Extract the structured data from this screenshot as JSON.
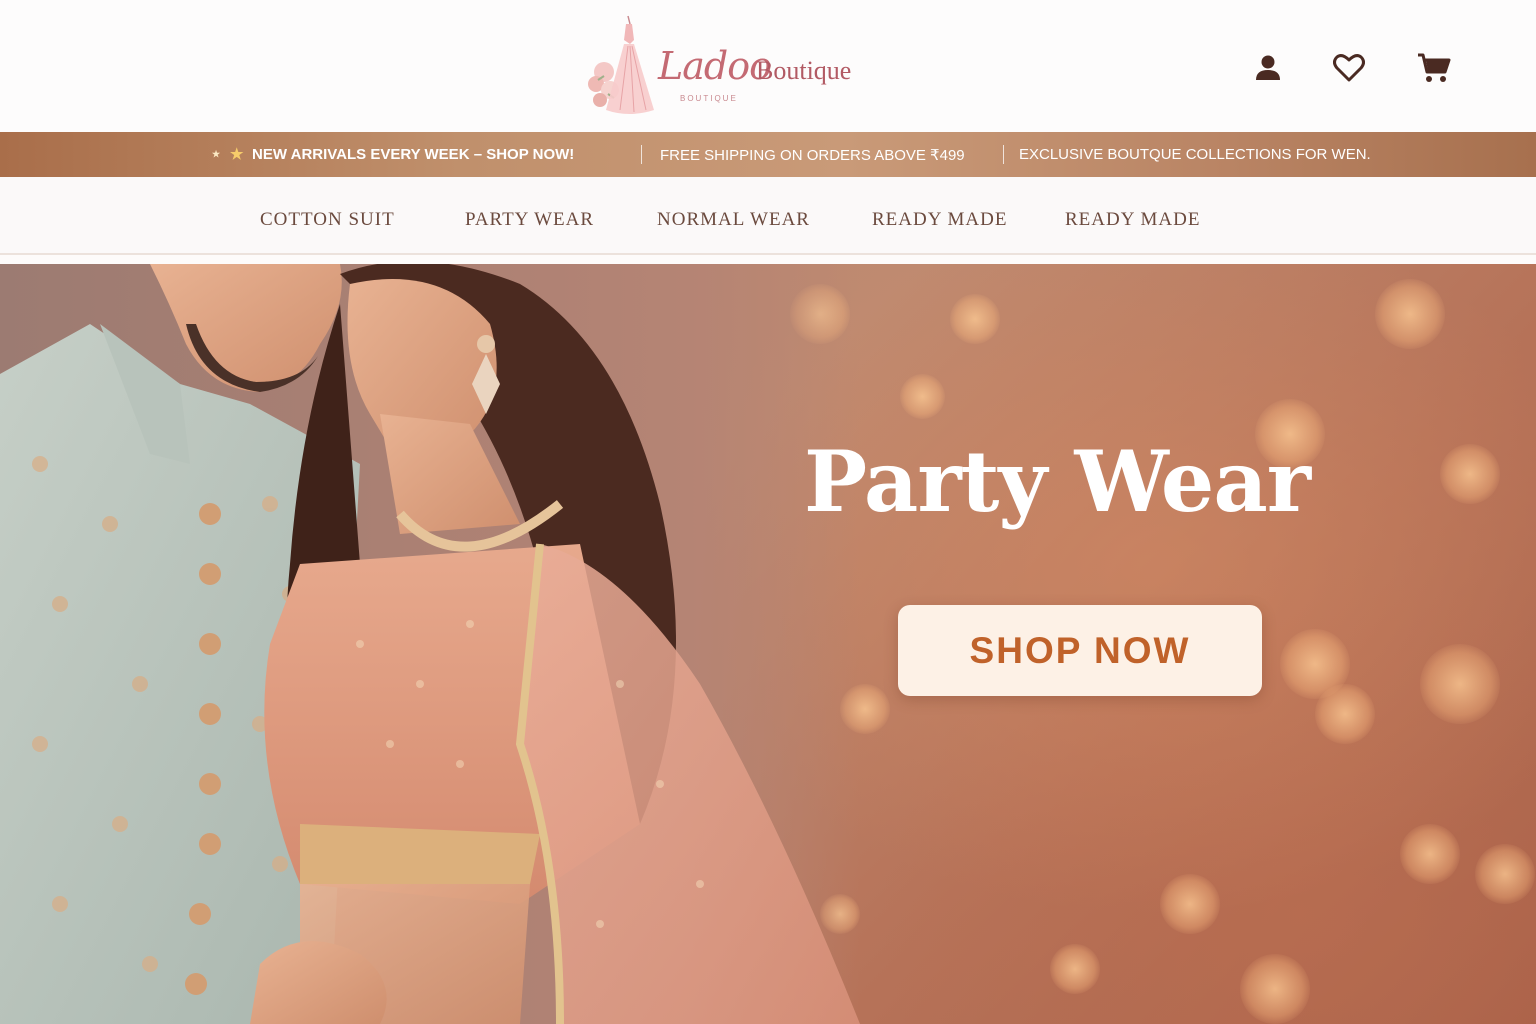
{
  "brand": {
    "script": "Ladoo",
    "word": "Boutique",
    "sub": "BOUTIQUE",
    "accent_color": "#c46a73"
  },
  "header_icons": [
    {
      "name": "user-icon"
    },
    {
      "name": "heart-icon"
    },
    {
      "name": "cart-icon"
    }
  ],
  "announcement": {
    "item1": "NEW ARRIVALS EVERY WEEK – SHOP NOW!",
    "item2": "FREE SHIPPING ON ORDERS ABOVE ₹499",
    "item3": "EXCLUSIVE BOUTQUE COLLECTIONS FOR WEN.",
    "star_small": "★",
    "star_big": "★"
  },
  "nav": {
    "items": [
      {
        "label": "COTTON SUIT"
      },
      {
        "label": "PARTY WEAR"
      },
      {
        "label": "NORMAL WEAR"
      },
      {
        "label": "READY MADE"
      },
      {
        "label": "READY MADE"
      }
    ]
  },
  "hero": {
    "title": "Party Wear",
    "cta_label": "SHOP NOW",
    "cta_text_color": "#c0622a"
  }
}
